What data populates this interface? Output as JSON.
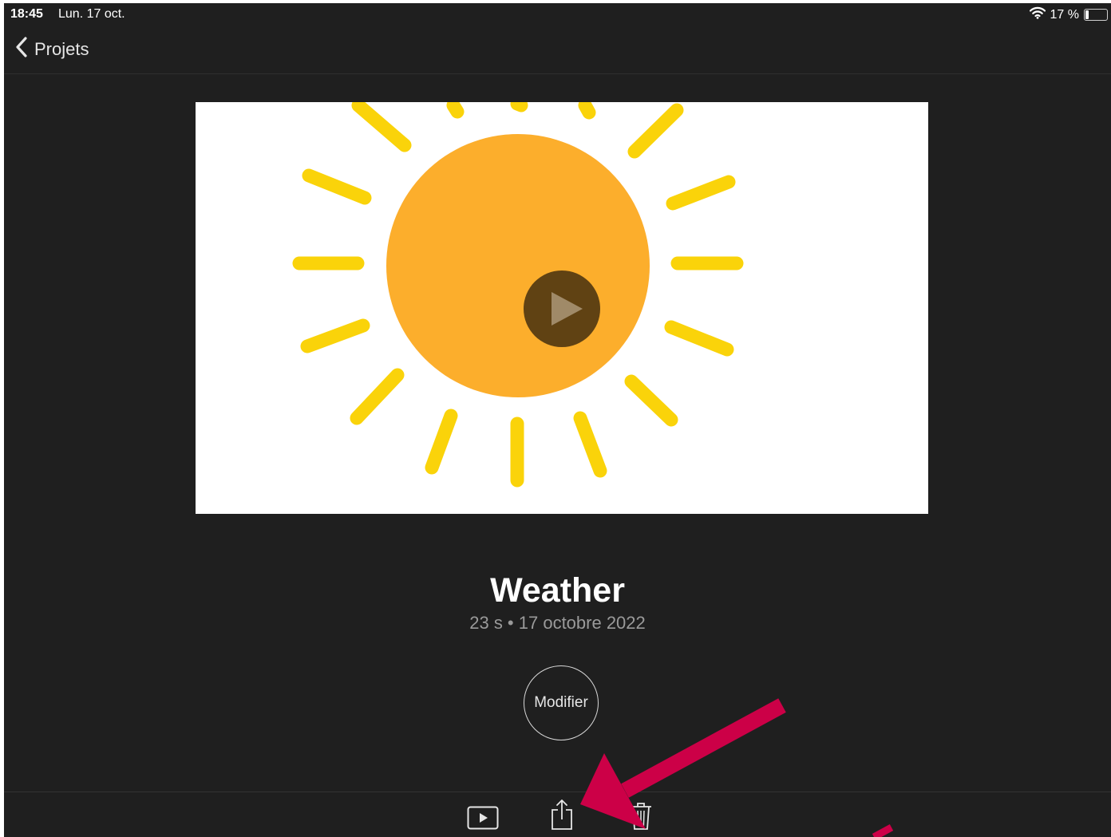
{
  "status_bar": {
    "time": "18:45",
    "date": "Lun. 17 oct.",
    "battery_text": "17 %",
    "battery_level": 0.17,
    "icons": [
      "wifi-icon",
      "battery-icon"
    ]
  },
  "nav": {
    "back_label": "Projets",
    "back_icon": "chevron-left-icon"
  },
  "project": {
    "title": "Weather",
    "meta": "23 s • 17 octobre 2022",
    "thumbnail": "sun-illustration",
    "play_icon": "play-icon"
  },
  "actions": {
    "modify_label": "Modifier"
  },
  "toolbar": {
    "items": [
      {
        "name": "play-video-button",
        "icon": "play-icon"
      },
      {
        "name": "share-button",
        "icon": "share-icon"
      },
      {
        "name": "delete-button",
        "icon": "trash-icon"
      }
    ]
  },
  "colors": {
    "background": "#1f1f1f",
    "sun": "#fcae2c",
    "rays": "#fad30a",
    "annotation_arrow": "#cc0047",
    "text_primary": "#ffffff",
    "text_secondary": "#9a9a9a"
  }
}
